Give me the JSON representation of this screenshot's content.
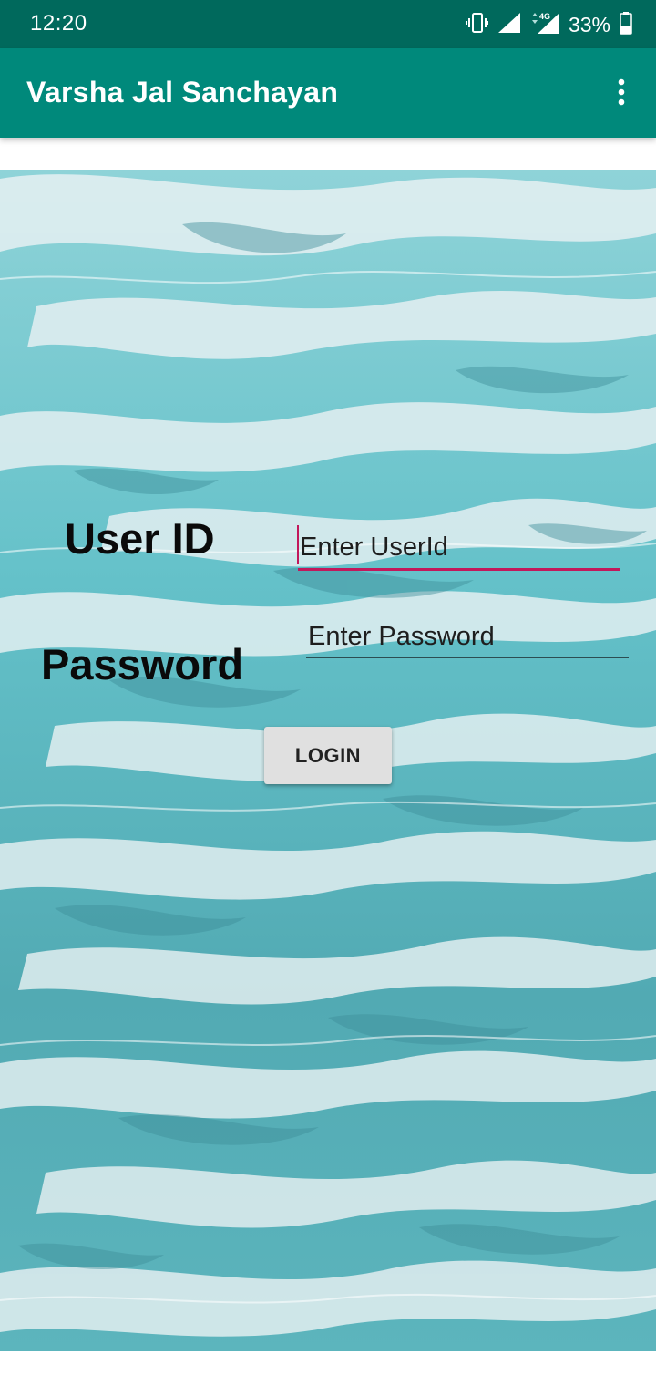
{
  "status_bar": {
    "time": "12:20",
    "network_label": "4G",
    "battery": "33%",
    "icons": [
      "vibrate-icon",
      "wifi-signal-icon",
      "cell-signal-icon",
      "battery-icon"
    ]
  },
  "app_bar": {
    "title": "Varsha Jal Sanchayan",
    "menu_icon": "more-vert-icon",
    "color": "#00897b",
    "status_color": "#00695c"
  },
  "login_form": {
    "userid_label": "User ID",
    "userid_placeholder": "Enter UserId",
    "password_label": "Password",
    "password_placeholder": "Enter Password",
    "login_button": "LOGIN",
    "accent_color": "#c2185b"
  },
  "background": {
    "description_icon": "water-texture"
  }
}
